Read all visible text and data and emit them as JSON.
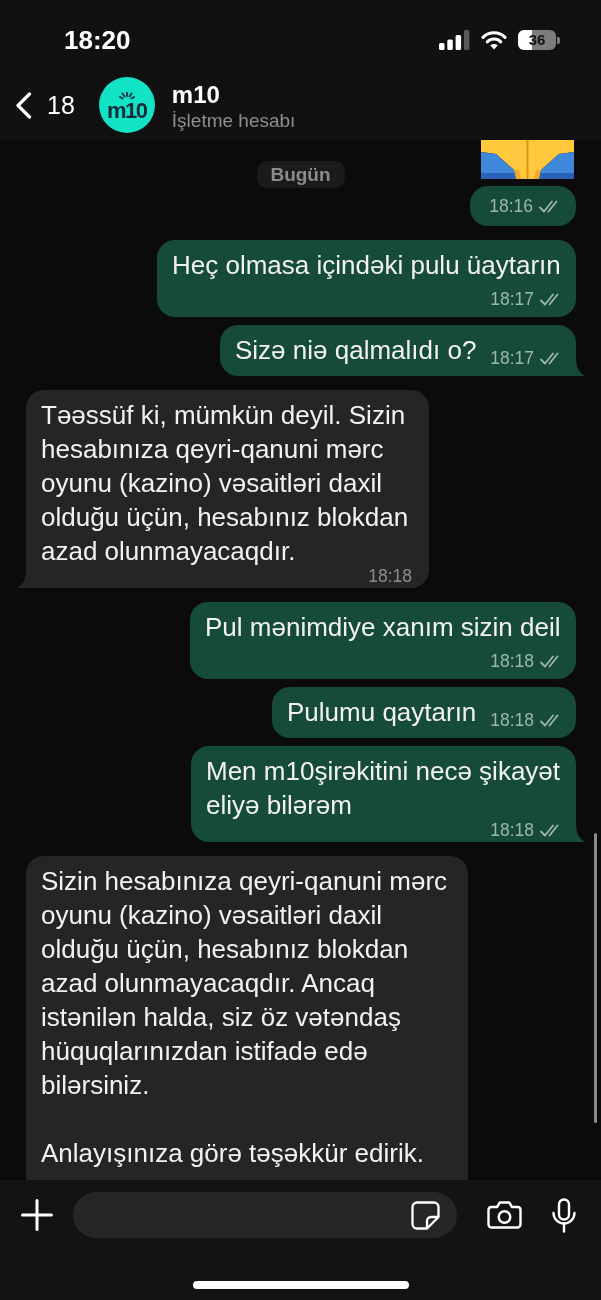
{
  "status_bar": {
    "time": "18:20",
    "battery": "36"
  },
  "header": {
    "back_count": "18",
    "avatar_logo": "m10",
    "name": "m10",
    "subtitle": "İşletme hesabı"
  },
  "date_chip": "Bugün",
  "messages": [
    {
      "kind": "emoji",
      "time": "18:16",
      "read": false,
      "tail": false
    },
    {
      "kind": "outgoing",
      "text": "Heç olmasa içindəki pulu üaytarın",
      "time": "18:17",
      "read": false,
      "tail": false
    },
    {
      "kind": "outgoing",
      "text": "Sizə niə qalmalıdı o?",
      "time": "18:17",
      "read": false,
      "tail": true
    },
    {
      "kind": "incoming",
      "text": "Təəssüf ki, mümkün deyil. Sizin\nhesabınıza qeyri-qanuni mərc\noyunu (kazino) vəsaitləri daxil\nolduğu üçün, hesabınız blokdan\nazad olunmayacaqdır.",
      "time": "18:18",
      "tail": true
    },
    {
      "kind": "outgoing",
      "text": "Pul mənimdiye xanım sizin deil",
      "time": "18:18",
      "read": false,
      "tail": false
    },
    {
      "kind": "outgoing",
      "text": "Pulumu qaytarın",
      "time": "18:18",
      "read": false,
      "tail": false
    },
    {
      "kind": "outgoing",
      "text": "Men m10şirəkitini necə şikayət\neliyə bilərəm",
      "time": "18:18",
      "read": false,
      "tail": true
    },
    {
      "kind": "incoming",
      "text": "Sizin hesabınıza qeyri-qanuni mərc\noyunu (kazino) vəsaitləri daxil\nolduğu üçün, hesabınız blokdan\nazad olunmayacaqdır. Ancaq\nistənilən halda, siz öz vətəndaş\nhüquqlarınızdan istifadə edə\nbilərsiniz.\n\nAnlayışınıza görə təşəkkür edirik."
    }
  ]
}
